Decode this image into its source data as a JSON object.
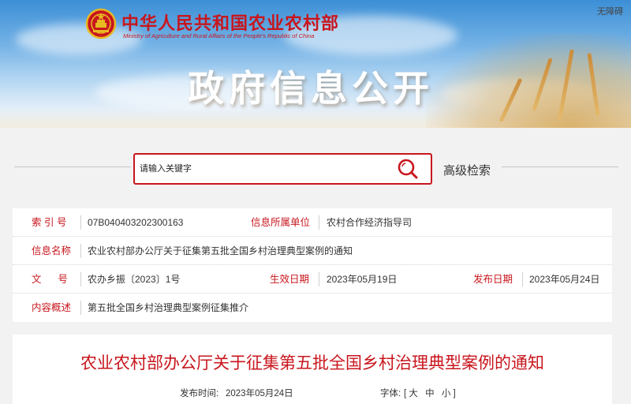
{
  "header": {
    "ministry_cn": "中华人民共和国农业农村部",
    "ministry_en": "Ministry of Agriculture and Rural Affairs of the People's Republic of China",
    "accessibility": "无障碍",
    "page_heading": "政府信息公开"
  },
  "search": {
    "placeholder": "请输入关键字",
    "advanced_label": "高级检索"
  },
  "meta": {
    "index_label": "索 引 号",
    "index_value": "07B040403202300163",
    "org_label": "信息所属单位",
    "org_value": "农村合作经济指导司",
    "name_label": "信息名称",
    "name_value": "农业农村部办公厅关于征集第五批全国乡村治理典型案例的通知",
    "doc_label": "文      号",
    "doc_value": "农办乡振〔2023〕1号",
    "effective_label": "生效日期",
    "effective_value": "2023年05月19日",
    "publish_label": "发布日期",
    "publish_value": "2023年05月24日",
    "summary_label": "内容概述",
    "summary_value": "第五批全国乡村治理典型案例征集推介"
  },
  "article": {
    "title": "农业农村部办公厅关于征集第五批全国乡村治理典型案例的通知",
    "publish_time_label": "发布时间:",
    "publish_time_value": "2023年05月24日",
    "font_label": "字体:",
    "font_open": "[",
    "font_large": "大",
    "font_medium": "中",
    "font_small": "小",
    "font_close": "]"
  },
  "colors": {
    "brand_red": "#c8161d",
    "sky_blue": "#74b2e6"
  },
  "icons": {
    "emblem": "national-emblem-icon",
    "search": "search-icon"
  }
}
